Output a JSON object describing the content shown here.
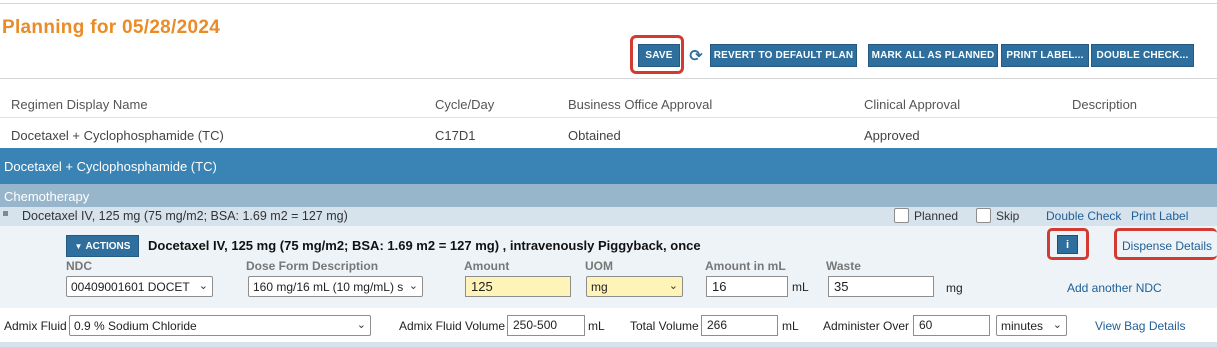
{
  "page": {
    "title": "Planning for 05/28/2024"
  },
  "toolbar": {
    "save": "SAVE",
    "refresh_icon": "refresh-icon",
    "revert": "REVERT TO DEFAULT PLAN",
    "mark_all": "MARK ALL AS PLANNED",
    "print_label": "PRINT LABEL...",
    "double_check": "DOUBLE CHECK..."
  },
  "regimen_table": {
    "headers": [
      "Regimen Display Name",
      "Cycle/Day",
      "Business Office Approval",
      "Clinical Approval",
      "Description"
    ],
    "rows": [
      [
        "Docetaxel + Cyclophosphamide (TC)",
        "C17D1",
        "Obtained",
        "Approved",
        ""
      ]
    ]
  },
  "regimen_bar": {
    "label": "Docetaxel + Cyclophosphamide (TC)"
  },
  "section": {
    "label": "Chemotherapy"
  },
  "drug": {
    "name": "Docetaxel IV, 125 mg (75 mg/m2; BSA: 1.69 m2 = 127 mg)",
    "planned_label": "Planned",
    "planned": false,
    "skip_label": "Skip",
    "skip": false,
    "double_check_link": "Double Check",
    "print_label_link": "Print Label"
  },
  "detail": {
    "actions_label": "ACTIONS",
    "order_line": "Docetaxel IV, 125 mg (75 mg/m2; BSA: 1.69 m2 = 127 mg) , intravenously Piggyback, once",
    "info_label": "i",
    "dispense_details": "Dispense Details",
    "labels": {
      "ndc": "NDC",
      "dose_form": "Dose Form Description",
      "amount": "Amount",
      "uom": "UOM",
      "amount_ml": "Amount in mL",
      "waste": "Waste"
    },
    "ndc_value": "00409001601 DOCET",
    "dose_form_value": "160 mg/16 mL (10 mg/mL) s",
    "amount_value": "125",
    "uom_value": "mg",
    "amount_ml_value": "16",
    "amount_ml_unit": "mL",
    "waste_value": "35",
    "waste_unit": "mg",
    "add_ndc": "Add another NDC"
  },
  "admix": {
    "fluid_label": "Admix Fluid",
    "fluid_value": "0.9 % Sodium Chloride",
    "volume_label": "Admix Fluid Volume",
    "volume_value": "250-500",
    "volume_unit": "mL",
    "total_label": "Total Volume",
    "total_value": "266",
    "total_unit": "mL",
    "administer_label": "Administer Over",
    "administer_value": "60",
    "administer_unit": "minutes",
    "view_bag": "View Bag Details"
  },
  "colors": {
    "title": "#e98b27",
    "button": "#2f6f9e",
    "regimen_bar": "#3a83b5",
    "section_bar": "#97b6cc",
    "highlight": "#d33b32",
    "yellow_field": "#fef4b8"
  }
}
